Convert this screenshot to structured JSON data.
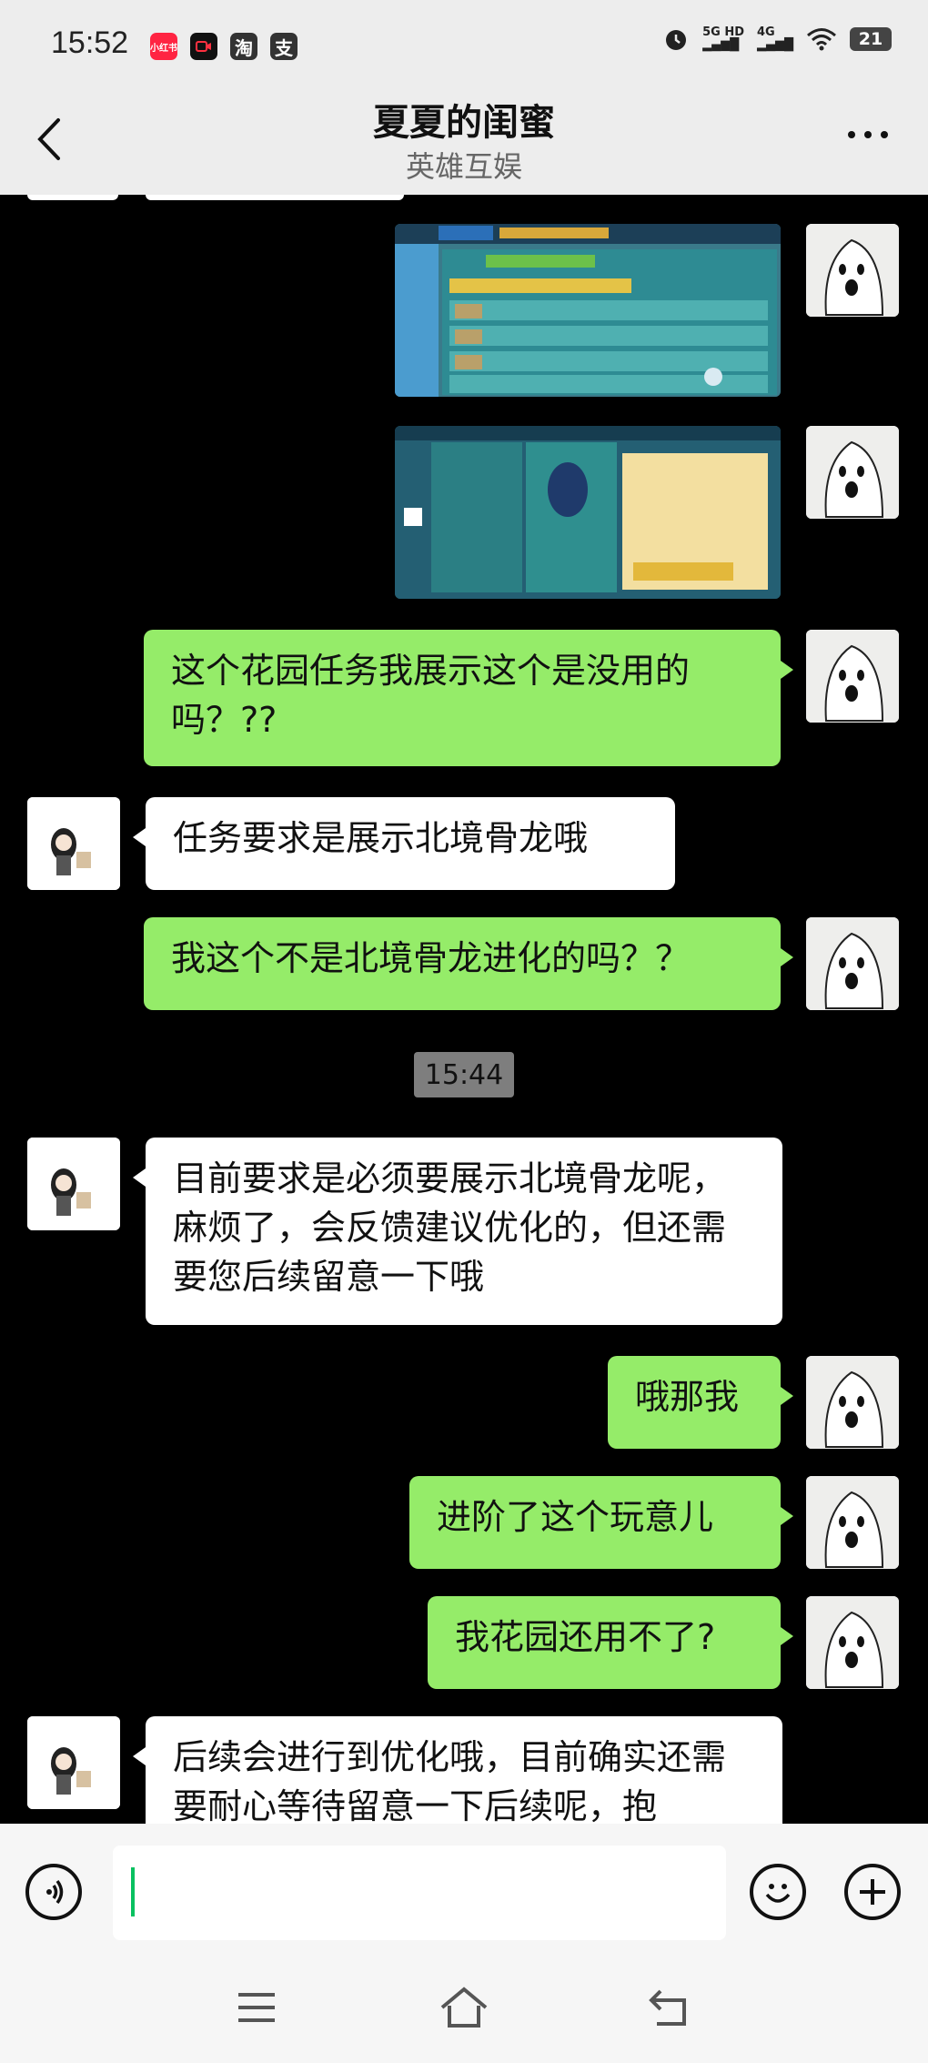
{
  "status_bar": {
    "time": "15:52",
    "apps": [
      {
        "name": "xiaohongshu-icon",
        "label": "小红书",
        "color": "#ff2442"
      },
      {
        "name": "record-icon",
        "label": "",
        "color": "#111111"
      },
      {
        "name": "taobao-icon",
        "label": "淘",
        "color": "#333333"
      },
      {
        "name": "alipay-icon",
        "label": "支",
        "color": "#333333"
      }
    ],
    "network": "5G HD",
    "network2": "4G",
    "battery": "21"
  },
  "header": {
    "title": "夏夏的闺蜜",
    "subtitle": "英雄互娱"
  },
  "messages": [
    {
      "sender": "me",
      "type": "image",
      "desc": "game-screenshot-garden"
    },
    {
      "sender": "me",
      "type": "image",
      "desc": "game-screenshot-character"
    },
    {
      "sender": "me",
      "type": "text",
      "text": "这个花园任务我展示这个是没用的吗？??"
    },
    {
      "sender": "them",
      "type": "text",
      "text": "任务要求是展示北境骨龙哦"
    },
    {
      "sender": "me",
      "type": "text",
      "text": "我这个不是北境骨龙进化的吗？？"
    },
    {
      "sender": "them",
      "type": "text",
      "text": "目前要求是必须要展示北境骨龙呢，麻烦了，会反馈建议优化的，但还需要您后续留意一下哦"
    },
    {
      "sender": "me",
      "type": "text",
      "text": "哦那我"
    },
    {
      "sender": "me",
      "type": "text",
      "text": "进阶了这个玩意儿"
    },
    {
      "sender": "me",
      "type": "text",
      "text": "我花园还用不了?"
    },
    {
      "sender": "them",
      "type": "text",
      "text": "后续会进行到优化哦，目前确实还需要耐心等待留意一下后续呢，抱"
    }
  ],
  "timestamp": "15:44",
  "input": {
    "value": "",
    "placeholder": ""
  },
  "colors": {
    "my_bubble": "#95ec69",
    "their_bubble": "#ffffff",
    "chat_background": "#000000",
    "header_background": "#ededed",
    "caret": "#07c160"
  }
}
